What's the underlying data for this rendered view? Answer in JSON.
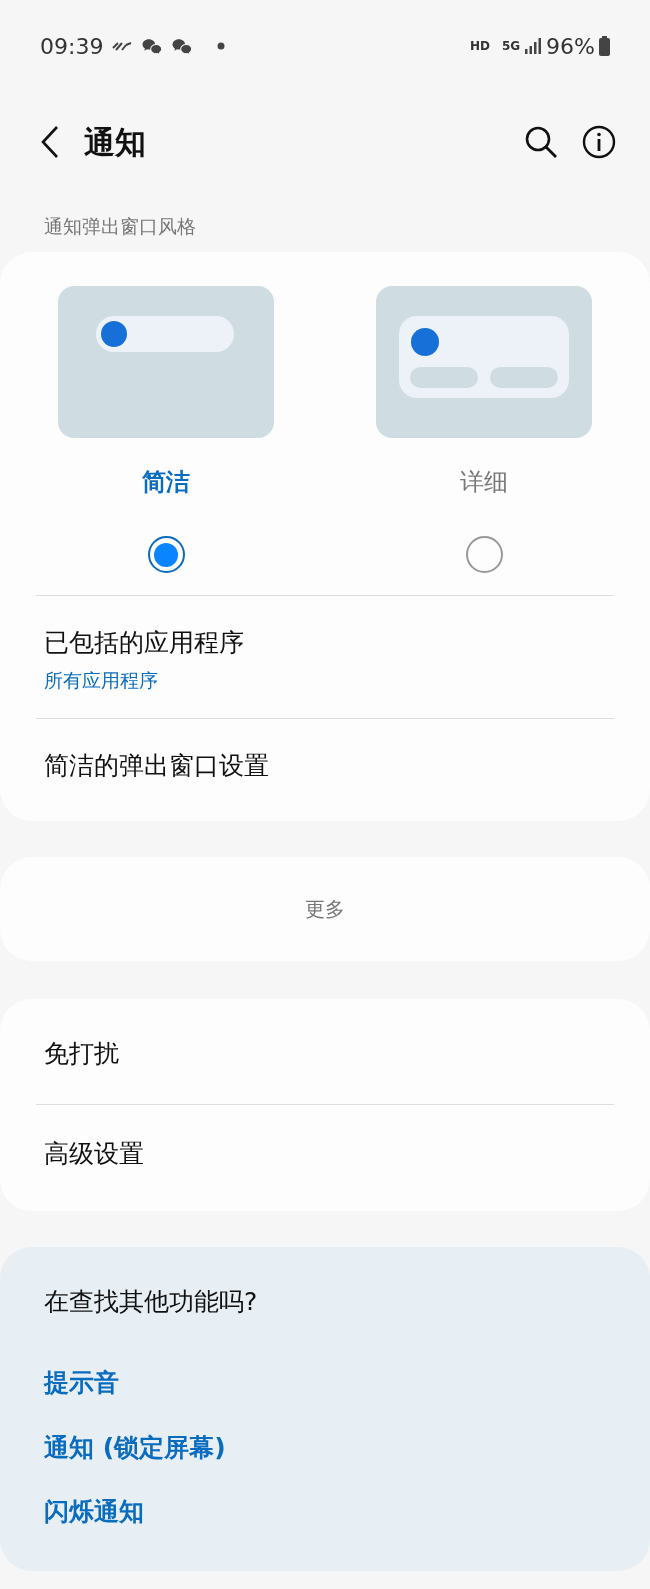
{
  "status_bar": {
    "time": "09:39",
    "network_badge": "HD",
    "network_type": "5G",
    "battery": "96%"
  },
  "header": {
    "title": "通知"
  },
  "popup_style": {
    "label": "通知弹出窗口风格",
    "options": [
      {
        "kind": "brief",
        "label": "简洁",
        "selected": true
      },
      {
        "kind": "detailed",
        "label": "详细",
        "selected": false
      }
    ],
    "items": [
      {
        "title": "已包括的应用程序",
        "subtitle": "所有应用程序"
      },
      {
        "title": "简洁的弹出窗口设置"
      }
    ]
  },
  "more_button": "更多",
  "settings": [
    {
      "title": "免打扰"
    },
    {
      "title": "高级设置"
    }
  ],
  "suggestions": {
    "title": "在查找其他功能吗?",
    "links": [
      "提示音",
      "通知 (锁定屏幕)",
      "闪烁通知"
    ]
  }
}
